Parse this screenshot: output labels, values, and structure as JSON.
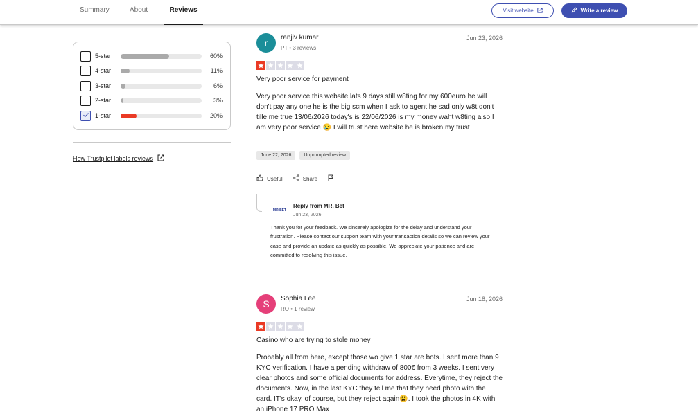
{
  "nav": {
    "tabs": [
      {
        "label": "Summary"
      },
      {
        "label": "About"
      },
      {
        "label": "Reviews"
      }
    ],
    "visit_label": "Visit website",
    "write_label": "Write a review"
  },
  "filters": {
    "rows": [
      {
        "label": "5-star",
        "pct": "60%",
        "fill": 60,
        "checked": false
      },
      {
        "label": "4-star",
        "pct": "11%",
        "fill": 11,
        "checked": false
      },
      {
        "label": "3-star",
        "pct": "6%",
        "fill": 6,
        "checked": false
      },
      {
        "label": "2-star",
        "pct": "3%",
        "fill": 3,
        "checked": false
      },
      {
        "label": "1-star",
        "pct": "20%",
        "fill": 20,
        "checked": true
      }
    ],
    "labels_link": "How Trustpilot labels reviews"
  },
  "reviews": [
    {
      "initial": "r",
      "avatar_color": "#1b8e99",
      "name": "ranjiv kumar",
      "meta": "PT • 3 reviews",
      "date": "Jun 23, 2026",
      "rating": 1,
      "title": "Very poor service for payment",
      "body": "Very poor service this website lats 9 days still w8ting for my 600euro he will don't pay any one he is the big scm when I ask to agent he sad only w8t don't tille me true 13/06/2026 today's is 22/06/2026 is my money waht w8ting also I am very poor service 😢 I will trust here website he is broken my trust",
      "tags": [
        "June 22, 2026",
        "Unprompted review"
      ],
      "actions": {
        "useful": "Useful",
        "share": "Share"
      },
      "reply": {
        "logo_text": "MR.BET",
        "from": "Reply from MR. Bet",
        "date": "Jun 23, 2026",
        "body": "Thank you for your feedback. We sincerely apologize for the delay and understand your frustration. Please contact our support team with your transaction details so we can review your case and provide an update as quickly as possible. We appreciate your patience and are committed to resolving this issue."
      }
    },
    {
      "initial": "S",
      "avatar_color": "#e53f79",
      "name": "Sophia Lee",
      "meta": "RO • 1 review",
      "date": "Jun 18, 2026",
      "rating": 1,
      "title": "Casino who are trying to stole money",
      "body": "Probably all from here, except those wo give 1 star are bots. I sent more than 9 KYC verification. I have a pending withdraw of 800€ from 3 weeks. I sent very clear photos and some official documents for address. Everytime, they reject the documents. Now, in the last KYC they tell me that they need photo with the card. IT's okay, of course, but they reject again😩. I took the photos in 4K with an iPhone 17 PRO Max"
    }
  ],
  "colors": {
    "accent": "#3e4fb1",
    "star_red": "#ea3a25",
    "star_empty": "#dcdce6"
  }
}
